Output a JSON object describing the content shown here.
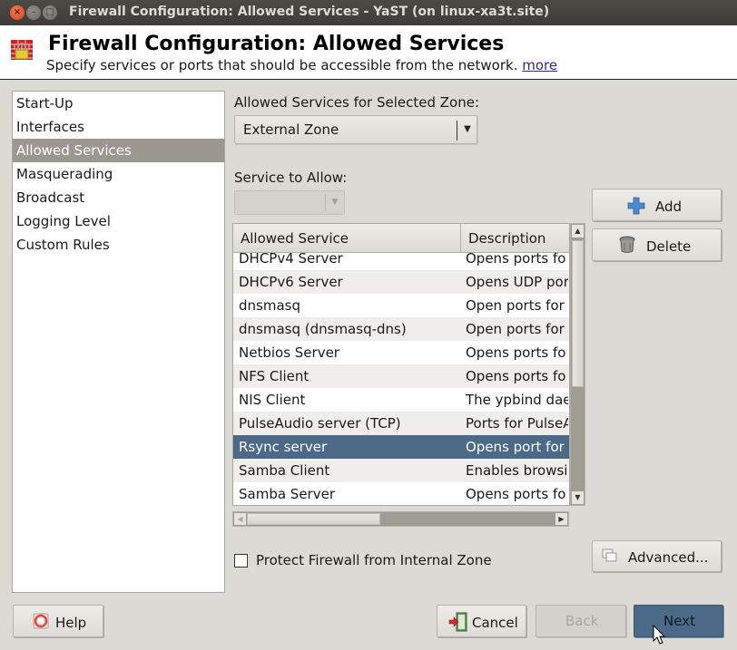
{
  "window": {
    "title": "Firewall Configuration: Allowed Services - YaST (on linux-xa3t.site)",
    "controls": [
      "close",
      "minimize",
      "maximize"
    ]
  },
  "header": {
    "icon": "firewall-icon",
    "title": "Firewall Configuration: Allowed Services",
    "subtitle": "Specify services or ports that should be accessible from the network.",
    "more_link": "more"
  },
  "nav": {
    "items": [
      {
        "label": "Start-Up",
        "selected": false
      },
      {
        "label": "Interfaces",
        "selected": false
      },
      {
        "label": "Allowed Services",
        "selected": true
      },
      {
        "label": "Masquerading",
        "selected": false
      },
      {
        "label": "Broadcast",
        "selected": false
      },
      {
        "label": "Logging Level",
        "selected": false
      },
      {
        "label": "Custom Rules",
        "selected": false
      }
    ]
  },
  "zone": {
    "label": "Allowed Services for Selected Zone:",
    "selected": "External Zone"
  },
  "service_to_allow": {
    "label": "Service to Allow:",
    "selected": ""
  },
  "buttons": {
    "add": "Add",
    "delete": "Delete",
    "advanced": "Advanced...",
    "help": "Help",
    "cancel": "Cancel",
    "back": "Back",
    "next": "Next"
  },
  "table": {
    "columns": [
      "Allowed Service",
      "Description"
    ],
    "rows": [
      {
        "service": "DHCPv4 Server",
        "description": "Opens ports fo"
      },
      {
        "service": "DHCPv6 Server",
        "description": "Opens UDP por"
      },
      {
        "service": "dnsmasq",
        "description": "Open ports for"
      },
      {
        "service": "dnsmasq (dnsmasq-dns)",
        "description": "Open ports for"
      },
      {
        "service": "Netbios Server",
        "description": "Opens ports fo"
      },
      {
        "service": "NFS Client",
        "description": "Opens ports fo"
      },
      {
        "service": "NIS Client",
        "description": "The ypbind dae"
      },
      {
        "service": "PulseAudio server (TCP)",
        "description": "Ports for PulseA"
      },
      {
        "service": "Rsync server",
        "description": "Opens port for",
        "selected": true
      },
      {
        "service": "Samba Client",
        "description": "Enables browsi"
      },
      {
        "service": "Samba Server",
        "description": "Opens ports fo"
      }
    ]
  },
  "protect_internal": {
    "label": "Protect Firewall from Internal Zone",
    "checked": false
  },
  "colors": {
    "selection": "#4c6a88",
    "nav_selection": "#9b988f",
    "background": "#dcdad5",
    "link": "#2a2aa8"
  }
}
